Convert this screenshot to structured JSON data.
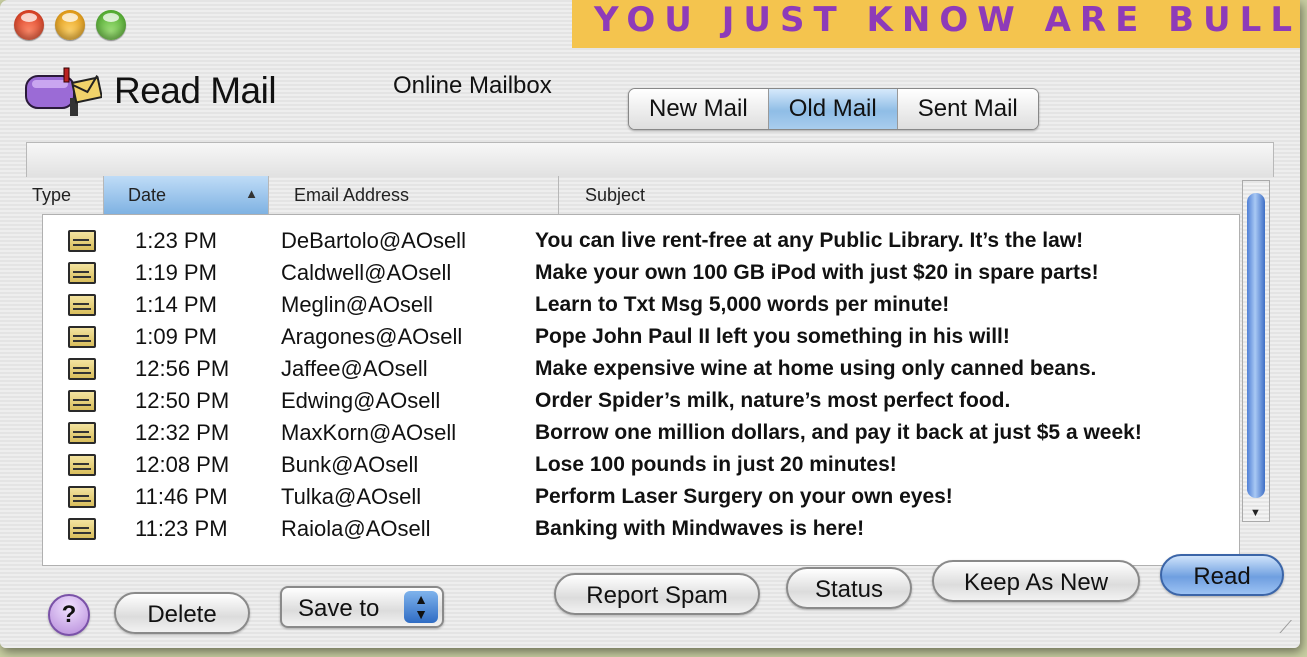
{
  "window": {
    "controls": [
      "close-button",
      "minimize-button",
      "zoom-button"
    ]
  },
  "banner": {
    "text": "YOU JUST KNOW ARE BULLSI"
  },
  "header": {
    "app_title": "Read Mail",
    "mailbox_label": "Online Mailbox",
    "app_icon": "mailbox-icon"
  },
  "tabs": [
    {
      "label": "New Mail",
      "active": false
    },
    {
      "label": "Old Mail",
      "active": true
    },
    {
      "label": "Sent Mail",
      "active": false
    }
  ],
  "columns": {
    "type": "Type",
    "date": "Date",
    "email": "Email Address",
    "subject": "Subject",
    "sort_indicator": "▲"
  },
  "messages": [
    {
      "icon": "envelope-icon",
      "date": "1:23 PM",
      "email": "DeBartolo@AOsell",
      "subject": "You can live rent-free at any Public Library. It’s the law!"
    },
    {
      "icon": "envelope-icon",
      "date": "1:19 PM",
      "email": "Caldwell@AOsell",
      "subject": "Make your own 100 GB iPod with just $20 in spare parts!"
    },
    {
      "icon": "envelope-icon",
      "date": "1:14 PM",
      "email": "Meglin@AOsell",
      "subject": "Learn to Txt Msg 5,000 words per minute!"
    },
    {
      "icon": "envelope-icon",
      "date": "1:09 PM",
      "email": "Aragones@AOsell",
      "subject": "Pope John Paul II left you something in his will!"
    },
    {
      "icon": "envelope-icon",
      "date": "12:56 PM",
      "email": "Jaffee@AOsell",
      "subject": "Make expensive wine at home using only canned beans."
    },
    {
      "icon": "envelope-icon",
      "date": "12:50 PM",
      "email": "Edwing@AOsell",
      "subject": "Order Spider’s milk, nature’s most perfect food."
    },
    {
      "icon": "envelope-icon",
      "date": "12:32 PM",
      "email": "MaxKorn@AOsell",
      "subject": "Borrow one million dollars, and pay it back at just $5 a week!"
    },
    {
      "icon": "envelope-icon",
      "date": "12:08 PM",
      "email": "Bunk@AOsell",
      "subject": "Lose 100 pounds in just 20 minutes!"
    },
    {
      "icon": "envelope-icon",
      "date": "11:46 PM",
      "email": "Tulka@AOsell",
      "subject": "Perform Laser Surgery on your own eyes!"
    },
    {
      "icon": "envelope-icon",
      "date": "11:23 PM",
      "email": "Raiola@AOsell",
      "subject": "Banking with Mindwaves is here!"
    }
  ],
  "footer": {
    "help_label": "?",
    "delete_label": "Delete",
    "save_label": "Save to",
    "report_spam_label": "Report Spam",
    "status_label": "Status",
    "keep_as_new_label": "Keep As New",
    "read_label": "Read"
  },
  "colors": {
    "banner_bg": "#f4c44e",
    "banner_text": "#8e3bb8",
    "accent_blue": "#7fb2e2"
  }
}
